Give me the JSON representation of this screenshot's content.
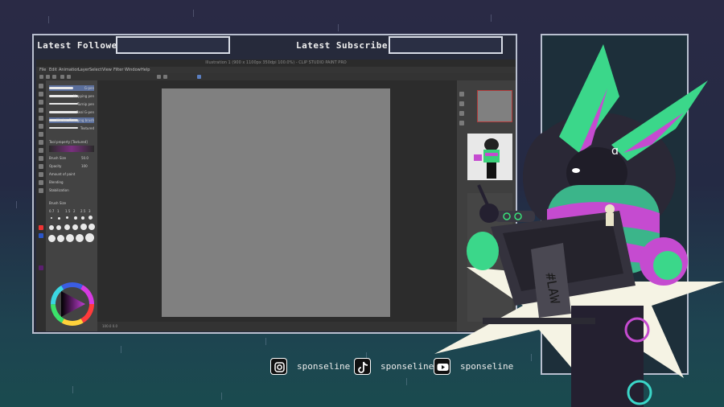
{
  "overlay": {
    "latest_follower_label": "Latest Follower:",
    "latest_follower_value": "",
    "latest_subscriber_label": "Latest Subscriber:",
    "latest_subscriber_value": ""
  },
  "app": {
    "title": "Illustration 1 (900 x 1100px 350dpi 100.0%) - CLIP STUDIO PAINT PRO",
    "menu": [
      "File",
      "Edit",
      "Animation",
      "Layer",
      "Select",
      "View",
      "Filter",
      "Window",
      "Help"
    ],
    "brushes": [
      {
        "name": "G-pen"
      },
      {
        "name": "Mapping pen"
      },
      {
        "name": "Turnip pen"
      },
      {
        "name": "Real G-pen"
      },
      {
        "name": "Marker Changing brush"
      },
      {
        "name": "Textured"
      }
    ],
    "tool_property": {
      "title": "Tool property [Textured]",
      "brush_size_label": "Brush Size",
      "brush_size_value": "50.0",
      "opacity_label": "Opacity",
      "opacity_value": "100",
      "amount_label": "Amount of paint",
      "blending_label": "Blending",
      "stabilization_label": "Stabilization"
    },
    "brush_size_panel": {
      "title": "Brush Size",
      "sizes": [
        "0.7",
        "1",
        "1.5",
        "2",
        "2.5",
        "3"
      ]
    },
    "status": "100.0   0.0"
  },
  "socials": [
    {
      "icon": "instagram-icon",
      "handle": "sponseline"
    },
    {
      "icon": "tiktok-icon",
      "handle": "sponseline"
    },
    {
      "icon": "youtube-icon",
      "handle": "sponseline"
    }
  ],
  "colors": {
    "accent_green": "#39e27a",
    "accent_pink": "#c54bd0",
    "frame": "#b9bfcf",
    "background_top": "#2a2a45",
    "background_bottom": "#1a4b4f"
  }
}
